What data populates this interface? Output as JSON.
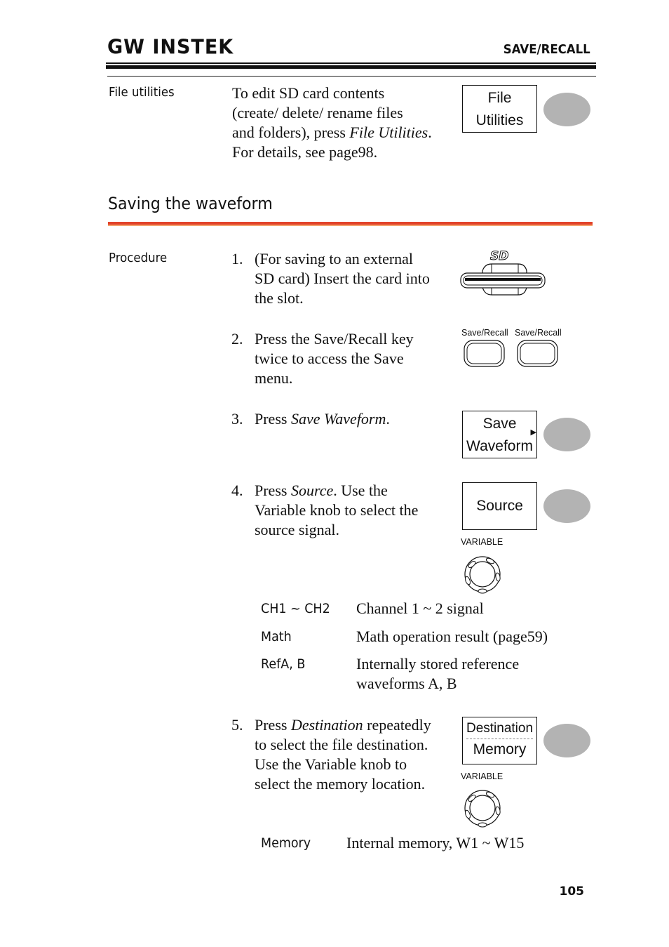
{
  "header": {
    "brand": "GW INSTEK",
    "section": "SAVE/RECALL"
  },
  "file_utilities": {
    "label": "File utilities",
    "text_lines": [
      "To edit SD card contents",
      "(create/ delete/ rename files",
      "and folders), press ",
      "File Utilities",
      ".",
      "For details, see page98."
    ],
    "softkey_line1": "File",
    "softkey_line2": "Utilities"
  },
  "section": {
    "title": "Saving the waveform",
    "accent_color": "#e2432a",
    "accent_light": "#f3a46e"
  },
  "procedure": {
    "label": "Procedure",
    "steps": [
      {
        "num": "1.",
        "lines": [
          "(For saving to an external",
          "SD card) Insert the card into",
          "the slot."
        ],
        "icon": "sd-card-slot-icon",
        "sd_logo": "SD"
      },
      {
        "num": "2.",
        "lines": [
          "Press the Save/Recall key",
          "twice to access the Save",
          "menu."
        ],
        "key_label_1": "Save/Recall",
        "key_label_2": "Save/Recall"
      },
      {
        "num": "3.",
        "prefix": "Press ",
        "emph": "Save Waveform",
        "suffix": ".",
        "softkey_line1": "Save",
        "softkey_line2": "Waveform"
      },
      {
        "num": "4.",
        "line1_prefix": "Press ",
        "line1_emph": "Source",
        "line1_suffix": ". Use the",
        "lines_rest": [
          "Variable knob to select the",
          "source signal."
        ],
        "softkey": "Source",
        "knob_label": "VARIABLE"
      },
      {
        "num": "5.",
        "line1_prefix": "Press ",
        "line1_emph": "Destination",
        "line1_suffix": " repeatedly",
        "lines_rest": [
          "to select the file destination.",
          "Use the Variable knob to",
          "select the memory location."
        ],
        "softkey_top": "Destination",
        "softkey_bottom": "Memory",
        "knob_label": "VARIABLE"
      }
    ],
    "source_table": [
      {
        "key": "CH1 ~ CH2",
        "value": "Channel 1 ~ 2 signal"
      },
      {
        "key": "Math",
        "value": "Math operation result (page59)"
      },
      {
        "key": "RefA, B",
        "value_lines": [
          "Internally stored reference",
          "waveforms A, B"
        ]
      }
    ],
    "destination_table": [
      {
        "key": "Memory",
        "value": "Internal memory, W1 ~ W15"
      }
    ]
  },
  "footer": {
    "page_number": "105"
  }
}
